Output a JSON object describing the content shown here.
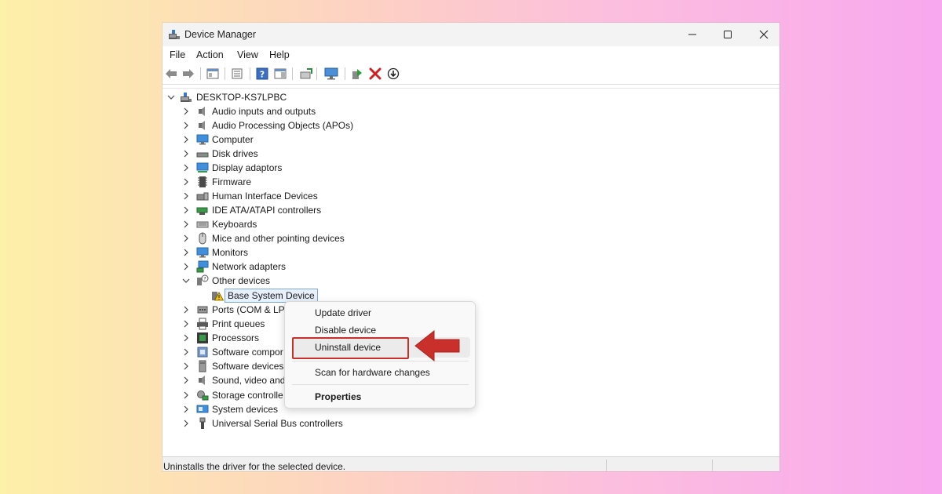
{
  "window": {
    "title": "Device Manager",
    "controls": {
      "minimize": "—",
      "maximize": "☐",
      "close": "✕"
    }
  },
  "menu": [
    "File",
    "Action",
    "View",
    "Help"
  ],
  "toolbar": {
    "icons": [
      "back-arrow-icon",
      "forward-arrow-icon",
      "show-hide-console-tree-icon",
      "properties-icon",
      "help-icon",
      "action-pane-icon",
      "update-driver-icon",
      "display-icon",
      "enable-device-icon",
      "uninstall-device-icon",
      "scan-hardware-icon"
    ]
  },
  "tree": {
    "root": "DESKTOP-KS7LPBC",
    "categories": [
      {
        "label": "Audio inputs and outputs",
        "icon": "speaker-icon"
      },
      {
        "label": "Audio Processing Objects (APOs)",
        "icon": "speaker-icon"
      },
      {
        "label": "Computer",
        "icon": "monitor-icon"
      },
      {
        "label": "Disk drives",
        "icon": "disk-icon"
      },
      {
        "label": "Display adaptors",
        "icon": "display-adapter-icon"
      },
      {
        "label": "Firmware",
        "icon": "chip-icon"
      },
      {
        "label": "Human Interface Devices",
        "icon": "hid-icon"
      },
      {
        "label": "IDE ATA/ATAPI controllers",
        "icon": "ide-icon"
      },
      {
        "label": "Keyboards",
        "icon": "keyboard-icon"
      },
      {
        "label": "Mice and other pointing devices",
        "icon": "mouse-icon"
      },
      {
        "label": "Monitors",
        "icon": "monitor-icon"
      },
      {
        "label": "Network adapters",
        "icon": "network-icon"
      },
      {
        "label": "Other devices",
        "icon": "unknown-device-icon",
        "expanded": true
      },
      {
        "label": "Base System Device",
        "icon": "warning-device-icon",
        "child": true,
        "selected": true
      },
      {
        "label": "Ports (COM & LP",
        "icon": "port-icon"
      },
      {
        "label": "Print queues",
        "icon": "printer-icon"
      },
      {
        "label": "Processors",
        "icon": "processor-icon"
      },
      {
        "label": "Software compor",
        "icon": "software-icon"
      },
      {
        "label": "Software devices",
        "icon": "software-device-icon"
      },
      {
        "label": "Sound, video and",
        "icon": "speaker-icon"
      },
      {
        "label": "Storage controlle",
        "icon": "storage-icon"
      },
      {
        "label": "System devices",
        "icon": "system-icon"
      },
      {
        "label": "Universal Serial Bus controllers",
        "icon": "usb-icon"
      }
    ]
  },
  "context_menu": {
    "items": [
      "Update driver",
      "Disable device",
      "Uninstall device",
      "Scan for hardware changes",
      "Properties"
    ],
    "highlighted": "Uninstall device"
  },
  "status": {
    "text": "Uninstalls the driver for the selected device."
  },
  "colors": {
    "highlight_box": "#c9302c",
    "arrow": "#c9302c",
    "selection": "#e8f0fb"
  }
}
